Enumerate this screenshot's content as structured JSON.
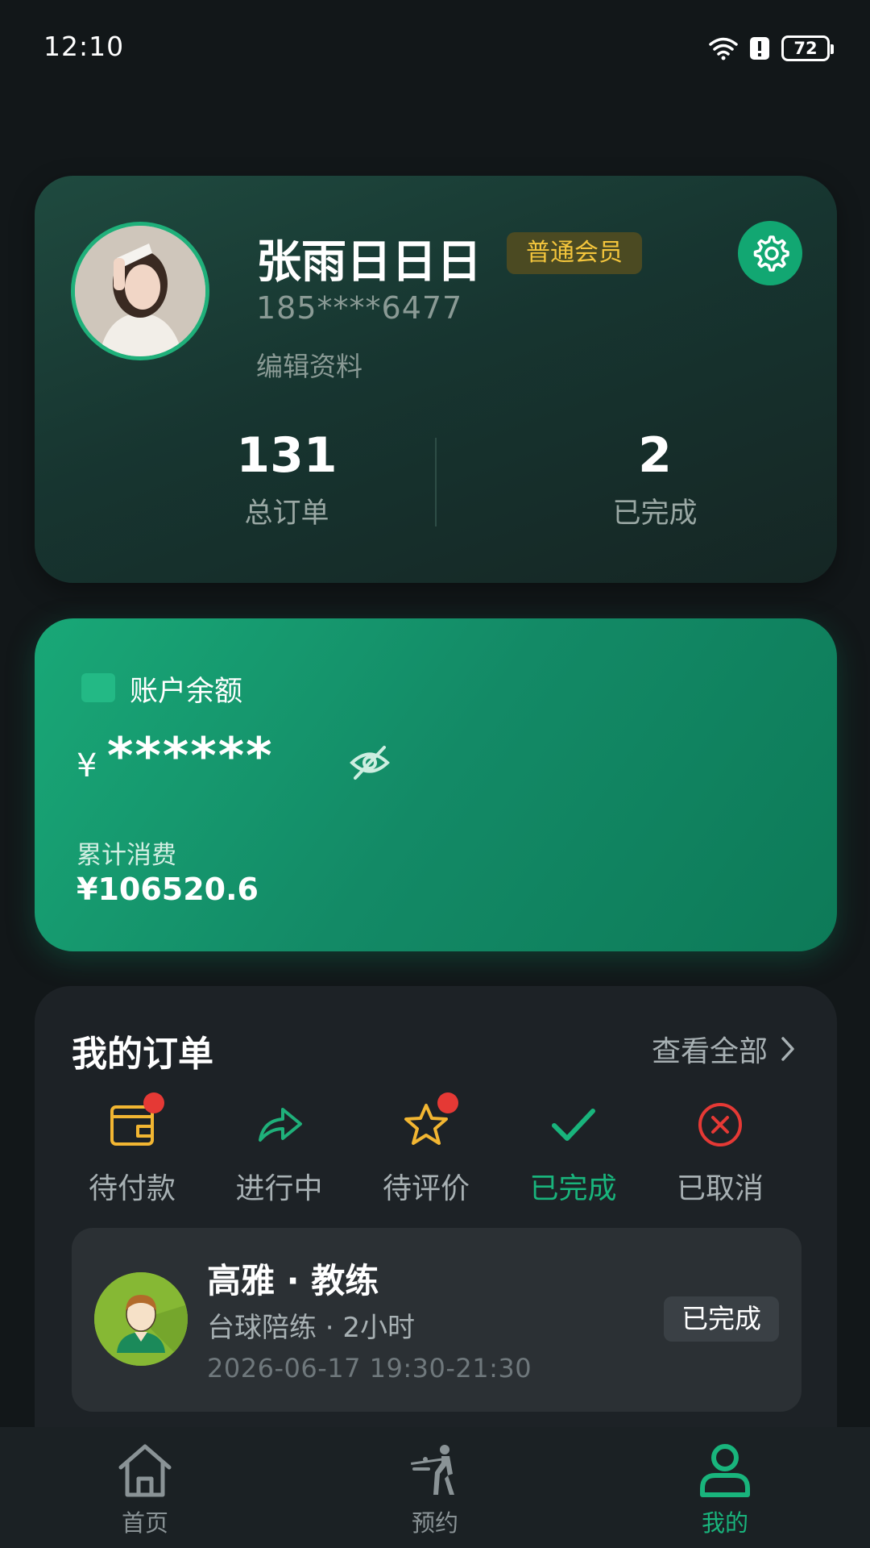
{
  "status_bar": {
    "time": "12:10",
    "battery": "72"
  },
  "profile": {
    "name": "张雨日日日",
    "member_level": "普通会员",
    "phone": "185****6477",
    "edit_label": "编辑资料",
    "stats": [
      {
        "value": "131",
        "label": "总订单"
      },
      {
        "value": "2",
        "label": "已完成"
      }
    ]
  },
  "balance": {
    "label": "账户余额",
    "currency": "¥",
    "masked_value": "******",
    "spend_label": "累计消费",
    "spend_value": "¥106520.6"
  },
  "orders": {
    "title": "我的订单",
    "view_all": "查看全部",
    "tabs": [
      {
        "label": "待付款",
        "icon": "wallet-icon",
        "badge": true
      },
      {
        "label": "进行中",
        "icon": "share-arrow-icon",
        "badge": false
      },
      {
        "label": "待评价",
        "icon": "star-icon",
        "badge": true
      },
      {
        "label": "已完成",
        "icon": "check-icon",
        "badge": false,
        "active": true
      },
      {
        "label": "已取消",
        "icon": "cancel-circle-icon",
        "badge": false
      }
    ],
    "item": {
      "coach": "高雅 · 教练",
      "service": "台球陪练 · 2小时",
      "time": "2026-06-17 19:30-21:30",
      "status": "已完成"
    }
  },
  "nav": {
    "items": [
      {
        "label": "首页",
        "icon": "home-icon"
      },
      {
        "label": "预约",
        "icon": "billiards-icon"
      },
      {
        "label": "我的",
        "icon": "user-icon",
        "active": true
      }
    ]
  },
  "colors": {
    "accent": "#19b47c",
    "badge": "#e53935",
    "gold": "#f3c53c"
  }
}
